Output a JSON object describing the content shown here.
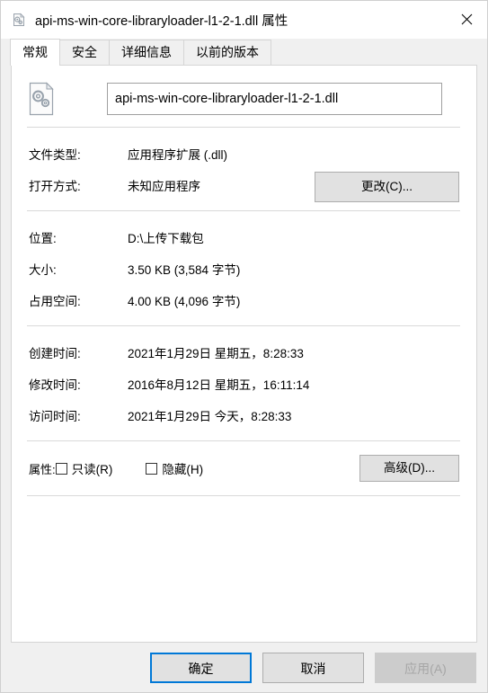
{
  "window": {
    "title": "api-ms-win-core-libraryloader-l1-2-1.dll 属性",
    "icon": "dll-file-icon",
    "close_label": "×"
  },
  "tabs": [
    {
      "label": "常规",
      "active": true
    },
    {
      "label": "安全",
      "active": false
    },
    {
      "label": "详细信息",
      "active": false
    },
    {
      "label": "以前的版本",
      "active": false
    }
  ],
  "general": {
    "file_icon": "dll-file-icon",
    "filename": "api-ms-win-core-libraryloader-l1-2-1.dll",
    "rows_group1": [
      {
        "label": "文件类型:",
        "value": "应用程序扩展 (.dll)"
      },
      {
        "label": "打开方式:",
        "value": "未知应用程序"
      }
    ],
    "change_button": "更改(C)...",
    "rows_group2": [
      {
        "label": "位置:",
        "value": "D:\\上传下载包"
      },
      {
        "label": "大小:",
        "value": "3.50 KB (3,584 字节)"
      },
      {
        "label": "占用空间:",
        "value": "4.00 KB (4,096 字节)"
      }
    ],
    "rows_group3": [
      {
        "label": "创建时间:",
        "value": "2021年1月29日 星期五，8:28:33"
      },
      {
        "label": "修改时间:",
        "value": "2016年8月12日 星期五，16:11:14"
      },
      {
        "label": "访问时间:",
        "value": "2021年1月29日 今天，8:28:33"
      }
    ],
    "attributes": {
      "label": "属性:",
      "readonly": {
        "label": "只读(R)",
        "checked": false
      },
      "hidden": {
        "label": "隐藏(H)",
        "checked": false
      },
      "advanced_button": "高级(D)..."
    }
  },
  "footer": {
    "ok": "确定",
    "cancel": "取消",
    "apply": "应用(A)",
    "apply_disabled": true
  },
  "colors": {
    "accent": "#0078d7",
    "panel_bg": "#ffffff",
    "dialog_bg": "#f0f0f0",
    "button_bg": "#e1e1e1",
    "border": "#d5d5d5"
  }
}
